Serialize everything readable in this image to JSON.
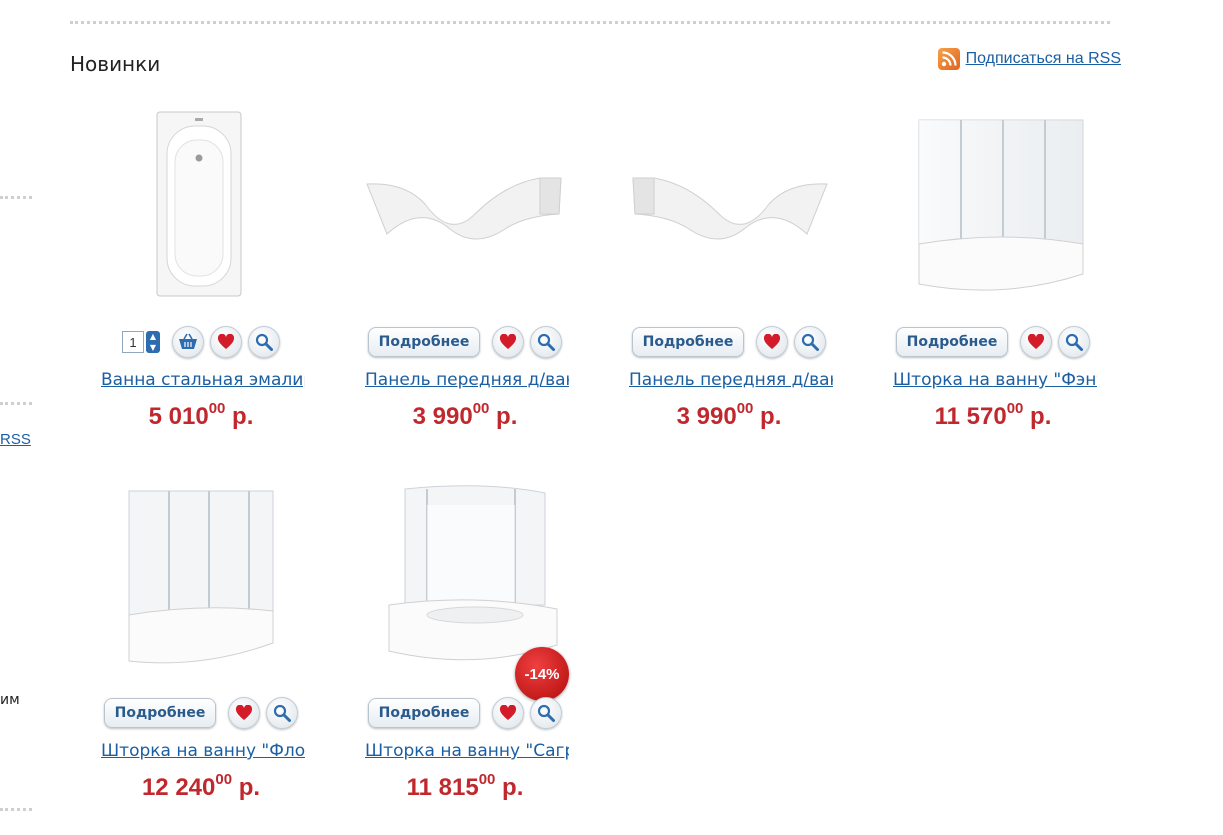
{
  "section": {
    "title": "Новинки"
  },
  "rss": {
    "label": "Подписаться на RSS"
  },
  "sidebar": {
    "rss_label": "RSS",
    "text_fragment": "им"
  },
  "products": [
    {
      "name": "Ванна стальная эмалированная",
      "price_main": "5 010",
      "price_cents": "00",
      "price_currency": " р.",
      "quantity": "1",
      "has_quantity": true
    },
    {
      "name": "Панель передняя д/ванны",
      "price_main": "3 990",
      "price_cents": "00",
      "price_currency": " р.",
      "more_label": "Подробнее"
    },
    {
      "name": "Панель передняя д/ванны",
      "price_main": "3 990",
      "price_cents": "00",
      "price_currency": " р.",
      "more_label": "Подробнее"
    },
    {
      "name": "Шторка на ванну \"Фэнтази\"",
      "price_main": "11 570",
      "price_cents": "00",
      "price_currency": " р.",
      "more_label": "Подробнее"
    },
    {
      "name": "Шторка на ванну \"Флора\"",
      "price_main": "12 240",
      "price_cents": "00",
      "price_currency": " р.",
      "more_label": "Подробнее"
    },
    {
      "name": "Шторка на ванну \"Сагра\"",
      "price_main": "11 815",
      "price_cents": "00",
      "price_currency": " р.",
      "more_label": "Подробнее",
      "discount": "-14%"
    }
  ],
  "colors": {
    "price": "#c0282e",
    "link": "#1a5fa3",
    "badge": "#d11a1a"
  }
}
